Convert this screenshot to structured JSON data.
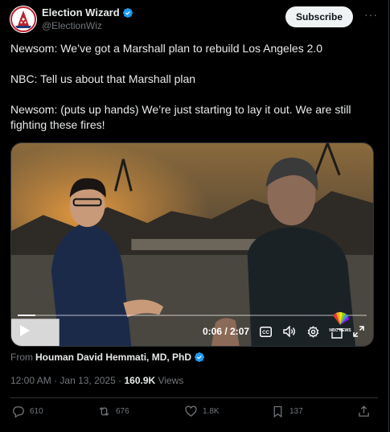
{
  "account": {
    "display_name": "Election Wizard",
    "handle": "@ElectionWiz",
    "verified": true
  },
  "header": {
    "subscribe_label": "Subscribe",
    "more_label": "···"
  },
  "tweet": {
    "lines": [
      "Newsom: We’ve got a Marshall plan to rebuild Los Angeles 2.0",
      "NBC: Tell us about that Marshall plan",
      "Newsom: (puts up hands) We’re just starting to lay it out. We are still fighting these fires!"
    ]
  },
  "video": {
    "time_display": "0:06 / 2:07",
    "progress_fraction": 0.05,
    "watermark": "NBC NEWS"
  },
  "attribution": {
    "prefix": "From",
    "name": "Houman David Hemmati, MD, PhD"
  },
  "meta": {
    "time": "12:00 AM",
    "separator": "·",
    "date": "Jan 13, 2025",
    "views_count": "160.9K",
    "views_label": "Views"
  },
  "actions": {
    "replies": "610",
    "reposts": "676",
    "likes": "1.8K",
    "bookmarks": "137"
  },
  "colors": {
    "background": "#000000",
    "text": "#e7e9ea",
    "secondary": "#71767b",
    "verified": "#1d9bf0",
    "border": "#2f3336"
  }
}
